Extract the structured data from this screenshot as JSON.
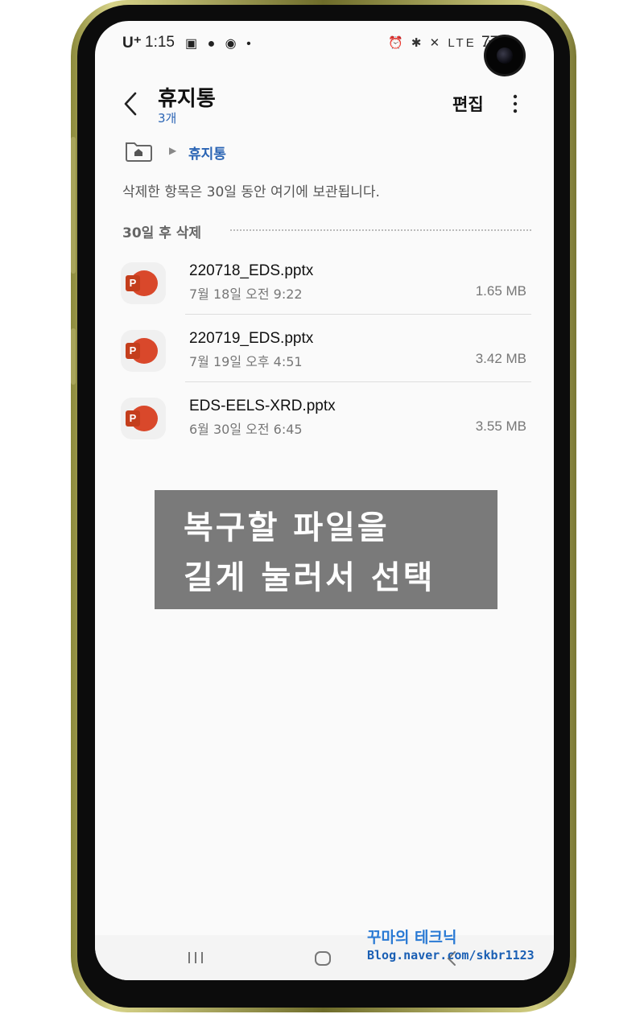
{
  "status_bar": {
    "carrier": "U⁺",
    "time": "1:15",
    "left_icons": "▣ ● ◉ •",
    "right_icons": "⏰ ✱ ✕ LTE .ıl",
    "battery": "77"
  },
  "header": {
    "title": "휴지통",
    "count": "3개",
    "edit_label": "편집"
  },
  "breadcrumb": {
    "current": "휴지통"
  },
  "notice": "삭제한 항목은 30일 동안 여기에 보관됩니다.",
  "section_label": "30일 후 삭제",
  "files": [
    {
      "name": "220718_EDS.pptx",
      "date": "7월 18일 오전 9:22",
      "size": "1.65 MB",
      "icon": "powerpoint-icon"
    },
    {
      "name": "220719_EDS.pptx",
      "date": "7월 19일 오후 4:51",
      "size": "3.42 MB",
      "icon": "powerpoint-icon"
    },
    {
      "name": "EDS-EELS-XRD.pptx",
      "date": "6월 30일 오전 6:45",
      "size": "3.55 MB",
      "icon": "powerpoint-icon"
    }
  ],
  "caption": {
    "line1": "복구할 파일을",
    "line2": "길게 눌러서 선택"
  },
  "watermark": {
    "title": "꾸마의 테크닉",
    "url": "Blog.naver.com/skbr1123"
  },
  "colors": {
    "accent": "#2a64b4",
    "ppt": "#d9482b",
    "caption_bg": "#7a7a7a"
  }
}
